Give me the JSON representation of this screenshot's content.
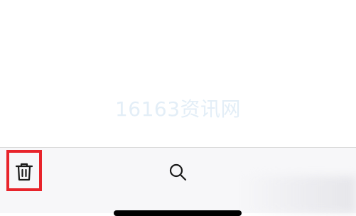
{
  "watermark": {
    "text": "16163资讯网"
  },
  "toolbar": {
    "items": [
      {
        "icon": "trash-icon",
        "highlighted": true
      },
      {
        "icon": "search-icon",
        "highlighted": false
      }
    ]
  },
  "colors": {
    "highlight": "#e8242b",
    "toolbar_bg": "#f7f7f9",
    "icon": "#1a1a1a",
    "watermark": "#e3eef7"
  }
}
